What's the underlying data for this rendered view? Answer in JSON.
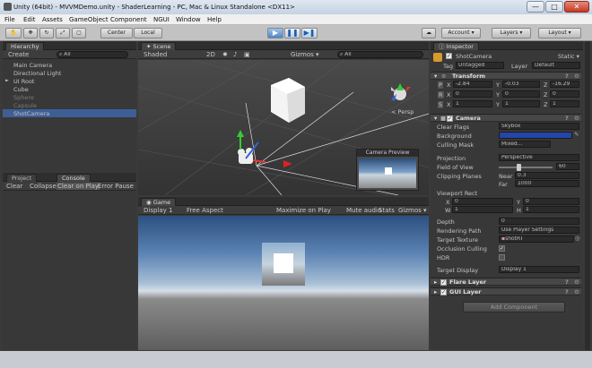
{
  "window": {
    "title": "Unity (64bit) - MVVMDemo.unity - ShaderLearning - PC, Mac & Linux Standalone <DX11>",
    "minimize": "—",
    "maximize": "□",
    "close": "✕"
  },
  "menu": [
    "File",
    "Edit",
    "Assets",
    "GameObject",
    "Component",
    "NGUI",
    "Window",
    "Help"
  ],
  "toolbar": {
    "center": "Center",
    "local": "Local",
    "play": "▶",
    "pause": "❚❚",
    "step": "▶❚",
    "account": "Account",
    "layers": "Layers",
    "layout": "Layout",
    "cloud": "☁"
  },
  "hierarchy": {
    "tab": "Hierarchy",
    "create": "Create",
    "search_placeholder": "All",
    "items": [
      {
        "label": "Main Camera",
        "dim": false,
        "arrow": ""
      },
      {
        "label": "Directional Light",
        "dim": false,
        "arrow": ""
      },
      {
        "label": "UI Root",
        "dim": false,
        "arrow": "►"
      },
      {
        "label": "Cube",
        "dim": false,
        "arrow": ""
      },
      {
        "label": "Sphere",
        "dim": true,
        "arrow": ""
      },
      {
        "label": "Capsule",
        "dim": true,
        "arrow": ""
      },
      {
        "label": "ShotCamera",
        "dim": false,
        "arrow": ""
      }
    ]
  },
  "console": {
    "project_tab": "Project",
    "console_tab": "Console",
    "buttons": [
      "Clear",
      "Collapse",
      "Clear on Play",
      "Error Pause"
    ]
  },
  "scene": {
    "tab": "Scene",
    "shading": "Shaded",
    "mode2d": "2D",
    "gizmos": "Gizmos ▾",
    "search_placeholder": "All",
    "persp": "< Persp",
    "preview_title": "Camera Preview"
  },
  "game": {
    "tab": "Game",
    "display": "Display 1",
    "aspect": "Free Aspect",
    "buttons": [
      "Maximize on Play",
      "Mute audio",
      "Stats",
      "Gizmos ▾"
    ]
  },
  "inspector": {
    "tab": "Inspector",
    "object_name": "ShotCamera",
    "static": "Static ▾",
    "tag_label": "Tag",
    "tag": "Untagged",
    "layer_label": "Layer",
    "layer": "Default",
    "transform": {
      "title": "Transform",
      "rows": [
        {
          "p": "P",
          "x": "-2.84",
          "y": "-0.03",
          "z": "-16.29"
        },
        {
          "p": "R",
          "x": "0",
          "y": "0",
          "z": "0"
        },
        {
          "p": "S",
          "x": "1",
          "y": "1",
          "z": "1"
        }
      ]
    },
    "camera": {
      "title": "Camera",
      "clear_flags_label": "Clear Flags",
      "clear_flags": "Skybox",
      "background_label": "Background",
      "culling_label": "Culling Mask",
      "culling": "Mixed...",
      "projection_label": "Projection",
      "projection": "Perspective",
      "fov_label": "Field of View",
      "fov": "60",
      "clipping_label": "Clipping Planes",
      "near_label": "Near",
      "near": "0.3",
      "far_label": "Far",
      "far": "1000",
      "viewport_label": "Viewport Rect",
      "vx": "0",
      "vy": "0",
      "vw": "1",
      "vh": "1",
      "depth_label": "Depth",
      "depth": "0",
      "render_label": "Rendering Path",
      "render": "Use Player Settings",
      "target_label": "Target Texture",
      "target": "shotRT",
      "occlusion_label": "Occlusion Culling",
      "hdr_label": "HDR",
      "display_label": "Target Display",
      "display": "Display 1"
    },
    "flare": "Flare Layer",
    "gui": "GUI Layer",
    "add_component": "Add Component"
  }
}
